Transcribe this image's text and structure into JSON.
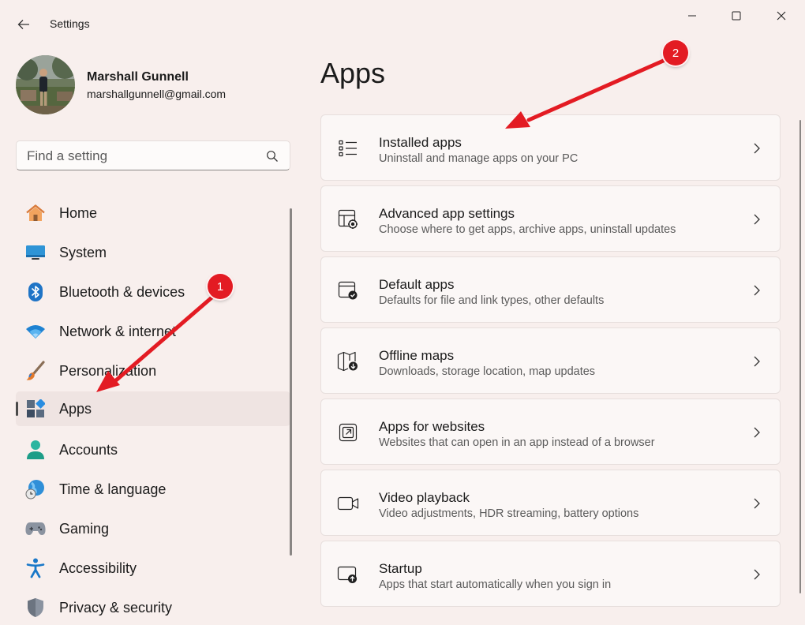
{
  "window": {
    "title": "Settings"
  },
  "profile": {
    "name": "Marshall Gunnell",
    "email": "marshallgunnell@gmail.com"
  },
  "search": {
    "placeholder": "Find a setting"
  },
  "sidebar": {
    "items": [
      {
        "label": "Home",
        "icon": "home-icon"
      },
      {
        "label": "System",
        "icon": "system-icon"
      },
      {
        "label": "Bluetooth & devices",
        "icon": "bluetooth-icon"
      },
      {
        "label": "Network & internet",
        "icon": "wifi-icon"
      },
      {
        "label": "Personalization",
        "icon": "brush-icon"
      },
      {
        "label": "Apps",
        "icon": "apps-icon",
        "selected": true
      },
      {
        "label": "Accounts",
        "icon": "accounts-icon"
      },
      {
        "label": "Time & language",
        "icon": "globe-clock-icon"
      },
      {
        "label": "Gaming",
        "icon": "gamepad-icon"
      },
      {
        "label": "Accessibility",
        "icon": "accessibility-icon"
      },
      {
        "label": "Privacy & security",
        "icon": "shield-icon"
      }
    ]
  },
  "main": {
    "title": "Apps",
    "cards": [
      {
        "title": "Installed apps",
        "subtitle": "Uninstall and manage apps on your PC",
        "icon": "list-icon"
      },
      {
        "title": "Advanced app settings",
        "subtitle": "Choose where to get apps, archive apps, uninstall updates",
        "icon": "app-settings-icon"
      },
      {
        "title": "Default apps",
        "subtitle": "Defaults for file and link types, other defaults",
        "icon": "default-apps-icon"
      },
      {
        "title": "Offline maps",
        "subtitle": "Downloads, storage location, map updates",
        "icon": "map-download-icon"
      },
      {
        "title": "Apps for websites",
        "subtitle": "Websites that can open in an app instead of a browser",
        "icon": "open-in-app-icon"
      },
      {
        "title": "Video playback",
        "subtitle": "Video adjustments, HDR streaming, battery options",
        "icon": "video-icon"
      },
      {
        "title": "Startup",
        "subtitle": "Apps that start automatically when you sign in",
        "icon": "startup-icon"
      }
    ]
  },
  "annotations": [
    {
      "number": "1",
      "target": "Apps"
    },
    {
      "number": "2",
      "target": "Installed apps"
    }
  ],
  "colors": {
    "background": "#f8efed",
    "annotation_red": "#e31b23",
    "card": "#fbf7f6"
  }
}
